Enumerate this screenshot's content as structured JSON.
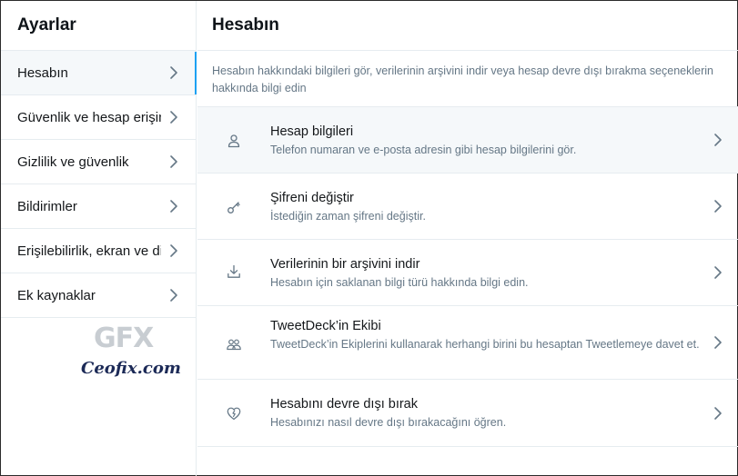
{
  "sidebar": {
    "title": "Ayarlar",
    "items": [
      {
        "label": "Hesabın",
        "active": true
      },
      {
        "label": "Güvenlik ve hesap erişimi"
      },
      {
        "label": "Gizlilik ve güvenlik"
      },
      {
        "label": "Bildirimler"
      },
      {
        "label": "Erişilebilirlik, ekran ve diller"
      },
      {
        "label": "Ek kaynaklar"
      }
    ]
  },
  "watermark": {
    "logo": "GFX",
    "text": "Ceofix.com"
  },
  "main": {
    "title": "Hesabın",
    "intro": "Hesabın hakkındaki bilgileri gör, verilerinin arşivini indir veya hesap devre dışı bırakma seçeneklerin hakkında bilgi edin",
    "rows": [
      {
        "title": "Hesap bilgileri",
        "subtitle": "Telefon numaran ve e-posta adresin gibi hesap bilgilerini gör.",
        "icon": "person-icon"
      },
      {
        "title": "Şifreni değiştir",
        "subtitle": "İstediğin zaman şifreni değiştir.",
        "icon": "key-icon"
      },
      {
        "title": "Verilerinin bir arşivini indir",
        "subtitle": "Hesabın için saklanan bilgi türü hakkında bilgi edin.",
        "icon": "download-icon"
      },
      {
        "title": "TweetDeck’in Ekibi",
        "subtitle": "TweetDeck’in Ekiplerini kullanarak herhangi birini bu hesaptan Tweetlemeye davet et.",
        "icon": "people-icon"
      },
      {
        "title": "Hesabını devre dışı bırak",
        "subtitle": "Hesabınızı nasıl devre dışı bırakacağını öğren.",
        "icon": "broken-heart-icon"
      }
    ]
  },
  "colors": {
    "accent": "#1da1f2",
    "border": "#e6ecf0",
    "muted_text": "#657786",
    "hover_bg": "#f5f8fa"
  }
}
